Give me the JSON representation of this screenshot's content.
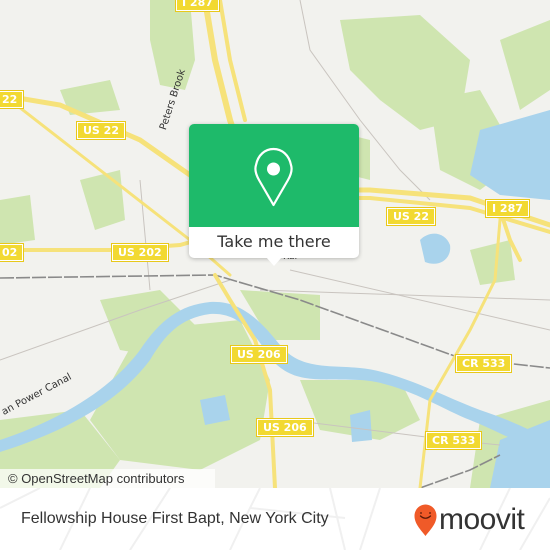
{
  "map": {
    "attribution": "© OpenStreetMap contributors",
    "road_shields": [
      {
        "label": "I 287",
        "id": "i287-north"
      },
      {
        "label": "22",
        "id": "us22-west"
      },
      {
        "label": "US 22",
        "id": "us22-center"
      },
      {
        "label": "US 22",
        "id": "us22-east"
      },
      {
        "label": "I 287",
        "id": "i287-east"
      },
      {
        "label": "02",
        "id": "us202-west"
      },
      {
        "label": "US 202",
        "id": "us202-center"
      },
      {
        "label": "US 206",
        "id": "us206-north"
      },
      {
        "label": "US 206",
        "id": "us206-south"
      },
      {
        "label": "CR 533",
        "id": "cr533-north"
      },
      {
        "label": "CR 533",
        "id": "cr533-south"
      }
    ],
    "labels": {
      "peters_brook": "Peters Brook",
      "power_canal": "an Power Canal",
      "partial_label": "Rar"
    },
    "colors": {
      "land": "#f2f2ee",
      "park": "#cfe5b0",
      "water": "#a9d3ec",
      "highway": "#f6e27a",
      "shield": "#f2d931"
    }
  },
  "popup": {
    "pin_icon": "map-pin-icon",
    "button_label": "Take me there",
    "accent_color": "#1eba6a"
  },
  "footer": {
    "title": "Fellowship House First Bapt, New York City",
    "brand": "moovit",
    "brand_color": "#f05a28"
  }
}
